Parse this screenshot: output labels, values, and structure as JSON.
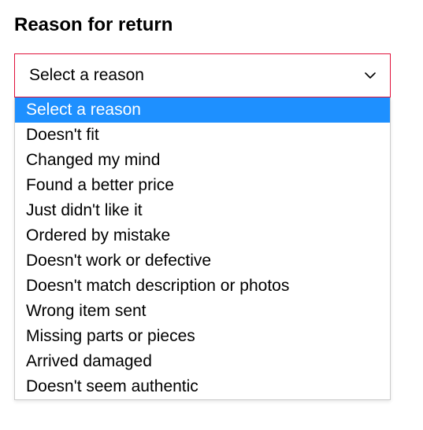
{
  "heading": "Reason for return",
  "select": {
    "selected_label": "Select a reason",
    "highlighted_index": 0,
    "options": [
      "Select a reason",
      "Doesn't fit",
      "Changed my mind",
      "Found a better price",
      "Just didn't like it",
      "Ordered by mistake",
      "Doesn't work or defective",
      "Doesn't match description or photos",
      "Wrong item sent",
      "Missing parts or pieces",
      "Arrived damaged",
      "Doesn't seem authentic"
    ]
  }
}
